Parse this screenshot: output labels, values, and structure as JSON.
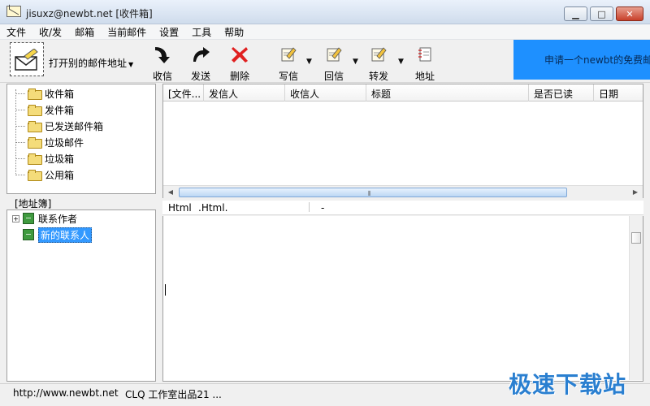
{
  "window": {
    "title": "jisuxz@newbt.net [收件箱]",
    "min_glyph": "▁",
    "max_glyph": "□",
    "close_glyph": "✕"
  },
  "menu": [
    "文件",
    "收/发",
    "邮箱",
    "当前邮件",
    "设置",
    "工具",
    "帮助"
  ],
  "toolbar": {
    "open_address": "打开别的邮件地址",
    "receive": "收信",
    "send": "发送",
    "delete": "删除",
    "compose": "写信",
    "reply": "回信",
    "forward": "转发",
    "address": "地址",
    "promo": "申请一个newbt的免费邮"
  },
  "folders": [
    "收件箱",
    "发件箱",
    "已发送邮件箱",
    "垃圾邮件",
    "垃圾箱",
    "公用箱"
  ],
  "address_book": {
    "header": "[地址簿]",
    "items": [
      "联系作者",
      "新的联系人"
    ]
  },
  "mail_list": {
    "columns": [
      "[文件...",
      "发信人",
      "收信人",
      "标题",
      "是否已读",
      "日期"
    ]
  },
  "preview_bar": {
    "html_label": "Html",
    "html_file": ".Html.",
    "dash": "-"
  },
  "status": {
    "url": "http://www.newbt.net",
    "credit": "CLQ 工作室出品21 ..."
  },
  "watermark": "极速下载站",
  "colors": {
    "promo_bg": "#1e90ff",
    "selection": "#3399ff",
    "delete_icon": "#e02020",
    "watermark": "#2a7fd0"
  },
  "icons": [
    "envelope-pencil-icon",
    "receive-arrow-icon",
    "send-arrow-icon",
    "delete-x-icon",
    "compose-icon",
    "reply-icon",
    "forward-icon",
    "address-book-icon",
    "folder-icon",
    "contact-book-icon"
  ]
}
